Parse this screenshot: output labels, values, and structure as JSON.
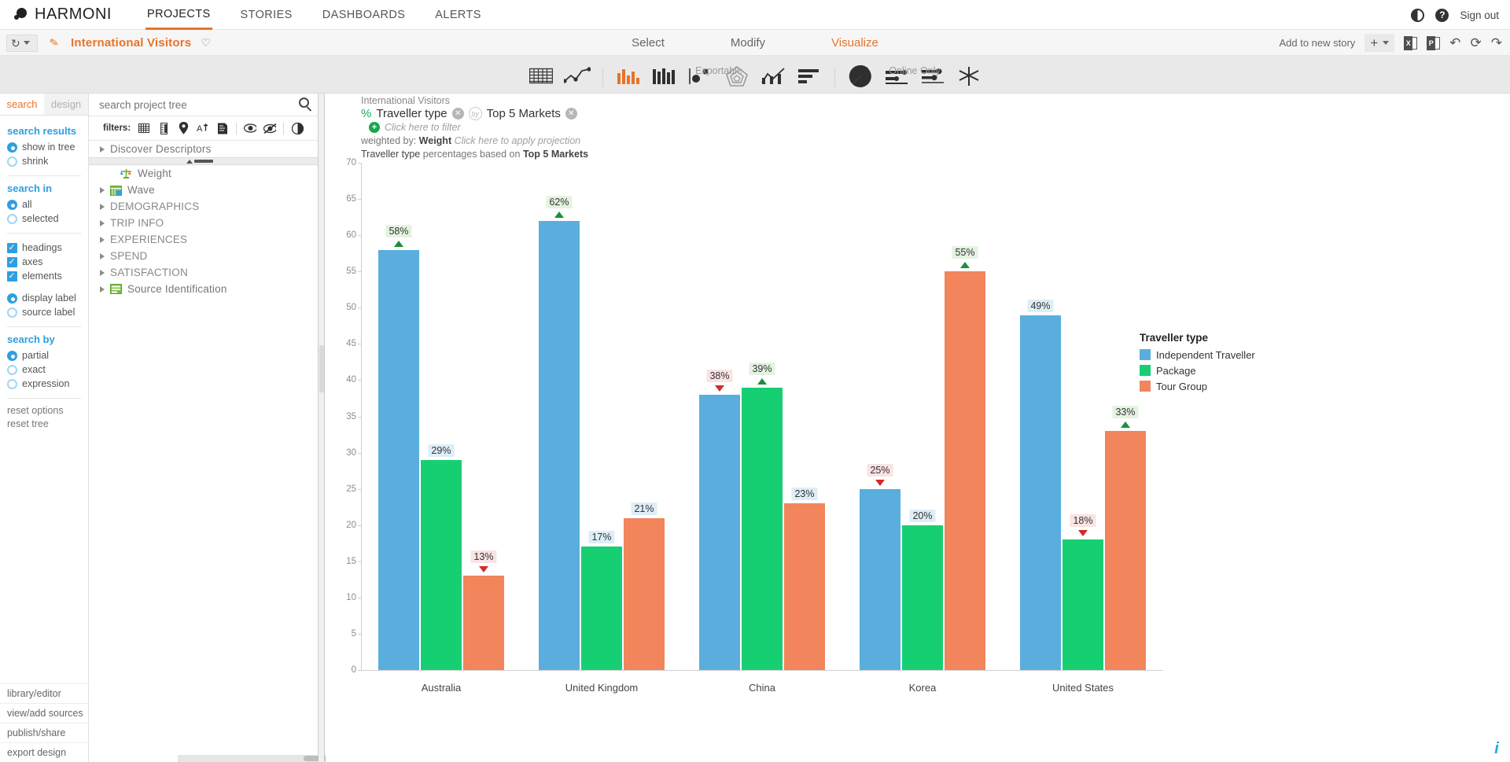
{
  "topbar": {
    "brand": "HARMONI",
    "nav": [
      {
        "label": "PROJECTS",
        "active": true
      },
      {
        "label": "STORIES",
        "active": false
      },
      {
        "label": "DASHBOARDS",
        "active": false
      },
      {
        "label": "ALERTS",
        "active": false
      }
    ],
    "contrast_icon": "contrast-icon",
    "help_icon": "help-icon",
    "signout": "Sign out"
  },
  "secondbar": {
    "history_icon": "history-icon",
    "edit_icon": "pencil-icon",
    "project_title": "International Visitors",
    "favorite_icon": "heart-icon",
    "steps": [
      {
        "label": "Select",
        "active": false
      },
      {
        "label": "Modify",
        "active": false
      },
      {
        "label": "Visualize",
        "active": true
      }
    ],
    "add_to_story": "Add to new story",
    "plus_label": "+",
    "excel_icon": "excel-export-icon",
    "powerpoint_icon": "powerpoint-export-icon",
    "undo_icon": "undo-icon",
    "refresh_icon": "refresh-icon",
    "share_icon": "share-icon"
  },
  "typebar": {
    "groups": [
      {
        "label": "",
        "icons": [
          {
            "name": "table-chart-icon",
            "active": false
          },
          {
            "name": "line-chart-icon",
            "active": false
          }
        ]
      },
      {
        "label": "Exportable",
        "icons": [
          {
            "name": "bar-chart-icon",
            "active": true
          },
          {
            "name": "stacked-column-icon",
            "active": false
          },
          {
            "name": "scatter-plot-icon",
            "active": false
          },
          {
            "name": "radar-chart-icon",
            "active": false
          },
          {
            "name": "combo-chart-icon",
            "active": false
          },
          {
            "name": "horizontal-bar-icon",
            "active": false
          }
        ]
      },
      {
        "label": "Online Only",
        "icons": [
          {
            "name": "pie-chart-icon",
            "active": false
          },
          {
            "name": "bullet-chart-icon",
            "active": false
          },
          {
            "name": "dot-plot-icon",
            "active": false
          },
          {
            "name": "correspondence-map-icon",
            "active": false
          }
        ]
      }
    ]
  },
  "left_panel": {
    "tabs": [
      {
        "label": "search",
        "active": true
      },
      {
        "label": "design",
        "active": false
      }
    ],
    "sections": [
      {
        "heading": "search results",
        "options": [
          {
            "type": "radio",
            "label": "show in tree",
            "checked": true
          },
          {
            "type": "radio",
            "label": "shrink",
            "checked": false
          }
        ]
      },
      {
        "heading": "search in",
        "options": [
          {
            "type": "radio",
            "label": "all",
            "checked": true
          },
          {
            "type": "radio",
            "label": "selected",
            "checked": false
          }
        ]
      },
      {
        "heading": "",
        "options": [
          {
            "type": "checkbox",
            "label": "headings",
            "checked": true
          },
          {
            "type": "checkbox",
            "label": "axes",
            "checked": true
          },
          {
            "type": "checkbox",
            "label": "elements",
            "checked": true
          }
        ]
      },
      {
        "heading": "",
        "options": [
          {
            "type": "radio",
            "label": "display label",
            "checked": true
          },
          {
            "type": "radio",
            "label": "source label",
            "checked": false
          }
        ]
      },
      {
        "heading": "search by",
        "options": [
          {
            "type": "radio",
            "label": "partial",
            "checked": true
          },
          {
            "type": "radio",
            "label": "exact",
            "checked": false
          },
          {
            "type": "radio",
            "label": "expression",
            "checked": false
          }
        ]
      }
    ],
    "resets": [
      "reset options",
      "reset tree"
    ],
    "bottom_items": [
      "library/editor",
      "view/add sources",
      "publish/share",
      "export design"
    ]
  },
  "tree_panel": {
    "search_placeholder": "search project tree",
    "search_value": "",
    "search_icon": "search-icon",
    "filters_label": "filters:",
    "filter_icons": [
      {
        "name": "grid-filter-icon"
      },
      {
        "name": "ruler-filter-icon"
      },
      {
        "name": "pin-filter-icon"
      },
      {
        "name": "text-filter-icon"
      },
      {
        "name": "note-filter-icon"
      },
      {
        "name": "visible-filter-icon"
      },
      {
        "name": "hidden-filter-icon"
      },
      {
        "name": "contrast-filter-icon"
      }
    ],
    "items": [
      {
        "label": "Discover Descriptors",
        "expandable": true,
        "icon": null,
        "indent": false,
        "caps": false
      },
      {
        "label": "Weight",
        "expandable": false,
        "icon": "weight-scale-icon",
        "indent": true,
        "caps": false
      },
      {
        "label": "Wave",
        "expandable": true,
        "icon": "calendar-icon",
        "indent": false,
        "caps": false
      },
      {
        "label": "DEMOGRAPHICS",
        "expandable": true,
        "icon": null,
        "indent": false,
        "caps": true
      },
      {
        "label": "TRIP INFO",
        "expandable": true,
        "icon": null,
        "indent": false,
        "caps": true
      },
      {
        "label": "EXPERIENCES",
        "expandable": true,
        "icon": null,
        "indent": false,
        "caps": true
      },
      {
        "label": "SPEND",
        "expandable": true,
        "icon": null,
        "indent": false,
        "caps": true
      },
      {
        "label": "SATISFACTION",
        "expandable": true,
        "icon": null,
        "indent": false,
        "caps": true
      },
      {
        "label": "Source Identification",
        "expandable": true,
        "icon": "source-id-icon",
        "indent": false,
        "caps": false
      }
    ]
  },
  "chart_header": {
    "project_name": "International Visitors",
    "percent_symbol": "%",
    "row_label": "Traveller type",
    "by_label": "by",
    "column_label": "Top 5 Markets",
    "filter_hint": "Click here to filter",
    "weighted_prefix": "weighted by:",
    "weighted_value": "Weight",
    "projection_hint": "Click here to apply projection",
    "basis_prefix": "Traveller type",
    "basis_mid": "percentages based on",
    "basis_value": "Top 5 Markets"
  },
  "chart_data": {
    "type": "bar",
    "title": "",
    "xlabel": "",
    "ylabel": "",
    "ylim": [
      0,
      70
    ],
    "yticks": [
      0,
      5,
      10,
      15,
      20,
      25,
      30,
      35,
      40,
      45,
      50,
      55,
      60,
      65,
      70
    ],
    "grid": false,
    "legend_title": "Traveller type",
    "legend_position": "right",
    "categories": [
      "Australia",
      "United Kingdom",
      "China",
      "Korea",
      "United States"
    ],
    "series": [
      {
        "name": "Independent Traveller",
        "color": "#5aaedd",
        "values": [
          58,
          62,
          38,
          25,
          49
        ],
        "labels": [
          "58%",
          "62%",
          "38%",
          "25%",
          "49%"
        ],
        "arrows": [
          "up",
          "up",
          "down",
          "down",
          "none"
        ]
      },
      {
        "name": "Package",
        "color": "#17cf73",
        "values": [
          29,
          17,
          39,
          20,
          18
        ],
        "labels": [
          "29%",
          "17%",
          "39%",
          "20%",
          "18%"
        ],
        "arrows": [
          "none",
          "none",
          "up",
          "none",
          "down"
        ]
      },
      {
        "name": "Tour Group",
        "color": "#f2855c",
        "values": [
          13,
          21,
          23,
          55,
          33
        ],
        "labels": [
          "13%",
          "21%",
          "23%",
          "55%",
          "33%"
        ],
        "arrows": [
          "down",
          "none",
          "none",
          "up",
          "up"
        ]
      }
    ]
  },
  "info_badge": "i"
}
